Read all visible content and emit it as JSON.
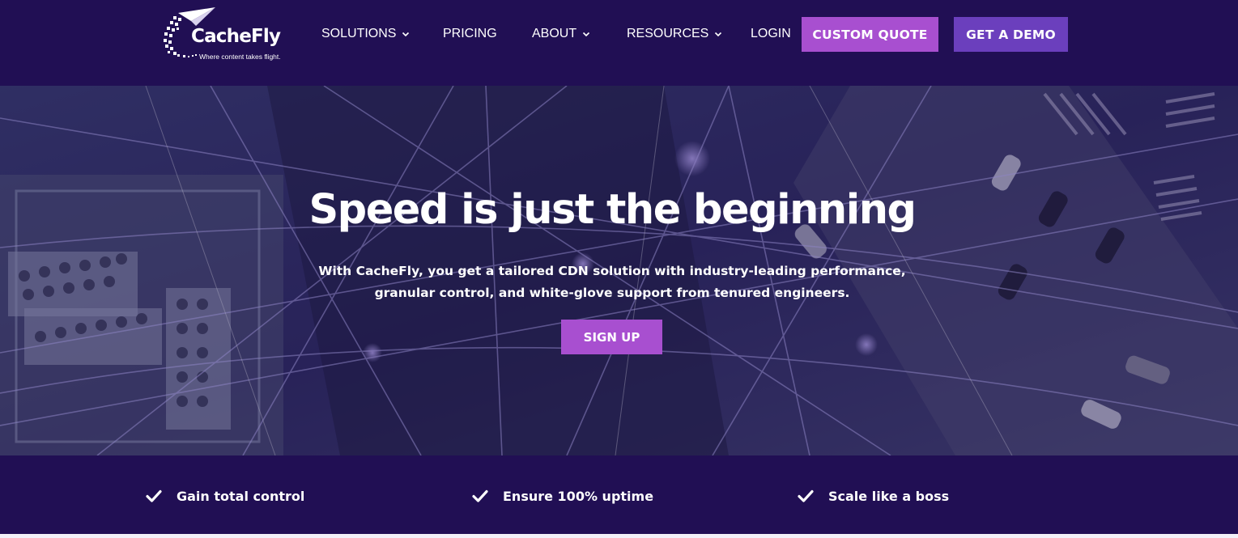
{
  "header": {
    "logo": {
      "name": "CacheFly",
      "tagline": "Where content takes flight."
    },
    "nav": [
      {
        "label": "SOLUTIONS",
        "has_dropdown": true
      },
      {
        "label": "PRICING",
        "has_dropdown": false
      },
      {
        "label": "ABOUT",
        "has_dropdown": true
      },
      {
        "label": "RESOURCES",
        "has_dropdown": true
      },
      {
        "label": "LOGIN",
        "has_dropdown": false
      }
    ],
    "buttons": {
      "quote": "CUSTOM QUOTE",
      "demo": "GET A DEMO"
    }
  },
  "hero": {
    "title": "Speed is just the beginning",
    "subtitle": "With CacheFly, you get a tailored CDN solution with industry-leading performance, granular control, and white-glove support from tenured engineers.",
    "cta": "SIGN UP"
  },
  "features": [
    {
      "label": "Gain total control",
      "icon": "check-icon"
    },
    {
      "label": "Ensure 100% uptime",
      "icon": "check-icon"
    },
    {
      "label": "Scale like a boss",
      "icon": "check-icon"
    }
  ],
  "colors": {
    "header_bg": "#210f54",
    "accent_purple": "#a84fd0",
    "demo_purple": "#6b3fbd",
    "text": "#ffffff"
  }
}
